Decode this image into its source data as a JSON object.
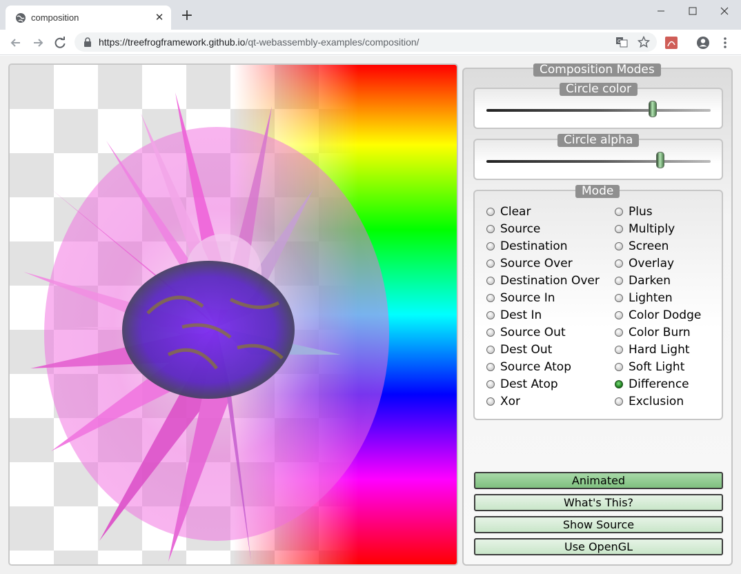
{
  "browser": {
    "tab_title": "composition",
    "new_tab_label": "+",
    "tab_close_label": "✕",
    "url_host": "https://treefrogframework.github.io",
    "url_path": "/qt-webassembly-examples/composition/",
    "icons": [
      "globe-icon",
      "close-icon",
      "plus-icon",
      "minimize-icon",
      "maximize-icon",
      "window-close-icon",
      "back-icon",
      "forward-icon",
      "reload-icon",
      "lock-icon",
      "translate-icon",
      "star-icon",
      "pdf-extension-icon",
      "profile-icon",
      "menu-icon"
    ]
  },
  "app": {
    "panel_title": "Composition Modes",
    "circle_color": {
      "title": "Circle color",
      "value": 0.75
    },
    "circle_alpha": {
      "title": "Circle alpha",
      "value": 0.785
    },
    "mode": {
      "title": "Mode",
      "left": [
        "Clear",
        "Source",
        "Destination",
        "Source Over",
        "Destination Over",
        "Source In",
        "Dest In",
        "Source Out",
        "Dest Out",
        "Source Atop",
        "Dest Atop",
        "Xor"
      ],
      "right": [
        "Plus",
        "Multiply",
        "Screen",
        "Overlay",
        "Darken",
        "Lighten",
        "Color Dodge",
        "Color Burn",
        "Hard Light",
        "Soft Light",
        "Difference",
        "Exclusion"
      ],
      "selected": "Difference"
    },
    "buttons": {
      "animated": "Animated",
      "whats_this": "What's This?",
      "show_source": "Show Source",
      "use_opengl": "Use OpenGL"
    },
    "colors": {
      "accent_green": "#7fc07f",
      "groupbox_title_bg": "#8f8f8f"
    }
  }
}
